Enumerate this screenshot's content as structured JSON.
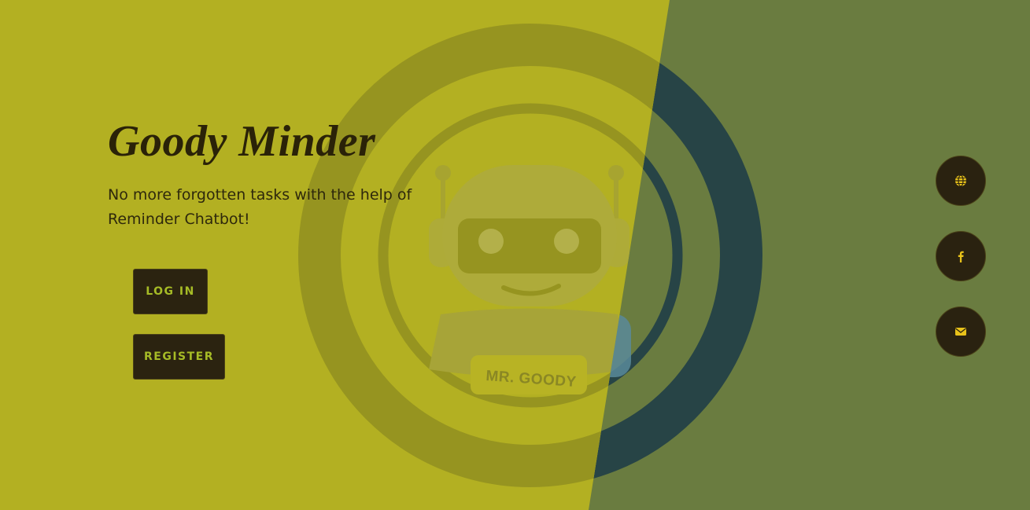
{
  "brand": {
    "title": "Goody Minder",
    "tagline": "No more forgotten tasks with the help of Reminder Chatbot!"
  },
  "actions": {
    "login_label": "LOG IN",
    "register_label": "REGISTER"
  },
  "hero": {
    "mascot_text": "MR. GOODY",
    "mascot_icon": "robot-mascot"
  },
  "social": [
    {
      "icon": "globe-icon"
    },
    {
      "icon": "facebook-icon"
    },
    {
      "icon": "email-icon"
    }
  ],
  "colors": {
    "left_panel": "#b3b022",
    "right_panel": "#6a7c40",
    "dark": "#2b2310",
    "accent_text": "#a6bb26",
    "icon_yellow": "#e8c21a"
  }
}
